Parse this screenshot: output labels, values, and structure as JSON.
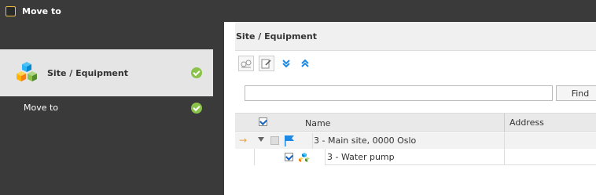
{
  "window": {
    "title": "Move to"
  },
  "steps": [
    {
      "label": "Site / Equipment",
      "status": "done"
    },
    {
      "label": "Move to",
      "status": "done"
    }
  ],
  "panel": {
    "title": "Site / Equipment"
  },
  "toolbar": {
    "buttons": [
      "select-site-icon",
      "edit-icon",
      "expand-all-icon",
      "collapse-all-icon"
    ]
  },
  "search": {
    "value": "",
    "placeholder": "",
    "find_label": "Find"
  },
  "grid": {
    "columns": [
      "Name",
      "Address"
    ],
    "rows": [
      {
        "name": "3 - Main site, 0000 Oslo",
        "address": "",
        "checked": false,
        "expanded": true,
        "icon": "flag-icon"
      },
      {
        "name": "3 - Water pump",
        "address": "",
        "checked": true,
        "icon": "equipment-icon"
      }
    ]
  },
  "colors": {
    "accent": "#1e88e5",
    "success": "#8bc34a",
    "dark": "#3a3a3a"
  }
}
